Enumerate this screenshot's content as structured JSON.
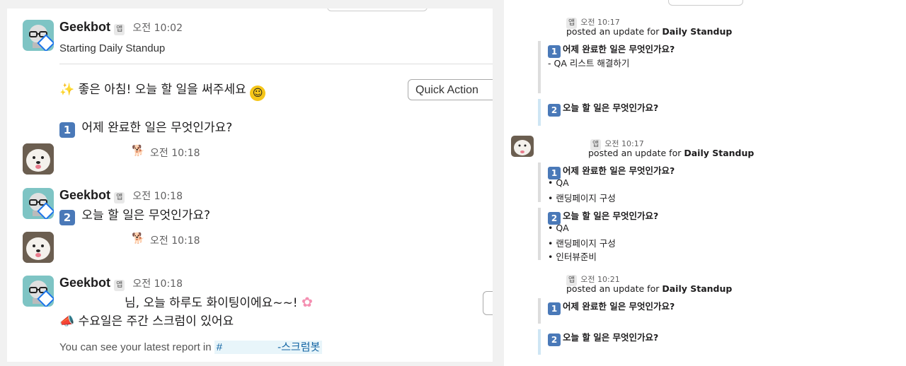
{
  "left": {
    "msg1": {
      "sender": "Geekbot",
      "app_badge": "앱",
      "time": "오전 10:02",
      "text": "Starting Daily Standup",
      "greeting": "좋은 아침! 오늘 할 일을 써주세요",
      "q1": "어제 완료한 일은 무엇인가요?",
      "q1_num": "1",
      "quick_action": "Quick Action"
    },
    "msg2": {
      "time": "오전 10:18"
    },
    "msg3": {
      "sender": "Geekbot",
      "app_badge": "앱",
      "time": "오전 10:18",
      "q2": "오늘 할 일은 무엇인가요?",
      "q2_num": "2"
    },
    "msg4": {
      "time": "오전 10:18"
    },
    "msg5": {
      "sender": "Geekbot",
      "app_badge": "앱",
      "time": "오전 10:18",
      "line1": "님, 오늘 하루도 화이팅이에요~~!",
      "line2": "수요일은 주간 스크럼이 있어요",
      "report_prefix": "You can see your latest report in",
      "channel_hash": "#",
      "channel_name": "-스크럼봇"
    }
  },
  "right": {
    "u1": {
      "app_badge": "앱",
      "time": "오전 10:17",
      "posted": "posted an update for",
      "standup": "Daily Standup",
      "q1_num": "1",
      "q1": "어제 완료한 일은 무엇인가요?",
      "a1": [
        "- QA 리스트 해결하기"
      ],
      "q2_num": "2",
      "q2": "오늘 할 일은 무엇인가요?"
    },
    "u2": {
      "app_badge": "앱",
      "time": "오전 10:17",
      "posted": "posted an update for",
      "standup": "Daily Standup",
      "q1_num": "1",
      "q1": "어제 완료한 일은 무엇인가요?",
      "a1": [
        "• QA",
        "• 랜딩페이지 구성"
      ],
      "q2_num": "2",
      "q2": "오늘 할 일은 무엇인가요?",
      "a2": [
        "• QA",
        "• 랜딩페이지 구성",
        "• 인터뷰준비"
      ]
    },
    "u3": {
      "app_badge": "앱",
      "time": "오전 10:21",
      "posted": "posted an update for",
      "standup": "Daily Standup",
      "q1_num": "1",
      "q1": "어제 완료한 일은 무엇인가요?",
      "q2_num": "2",
      "q2": "오늘 할 일은 무엇인가요?"
    }
  },
  "colors": {
    "link": "#1264a3",
    "keycap": "#4a79b8",
    "bot_avatar": "#7ec4c4"
  },
  "icons": [
    "geekbot-avatar",
    "dog-avatar",
    "sparkles-emoji",
    "grinning-emoji",
    "cherry-blossom-emoji",
    "megaphone-emoji",
    "dog-status-emoji"
  ]
}
